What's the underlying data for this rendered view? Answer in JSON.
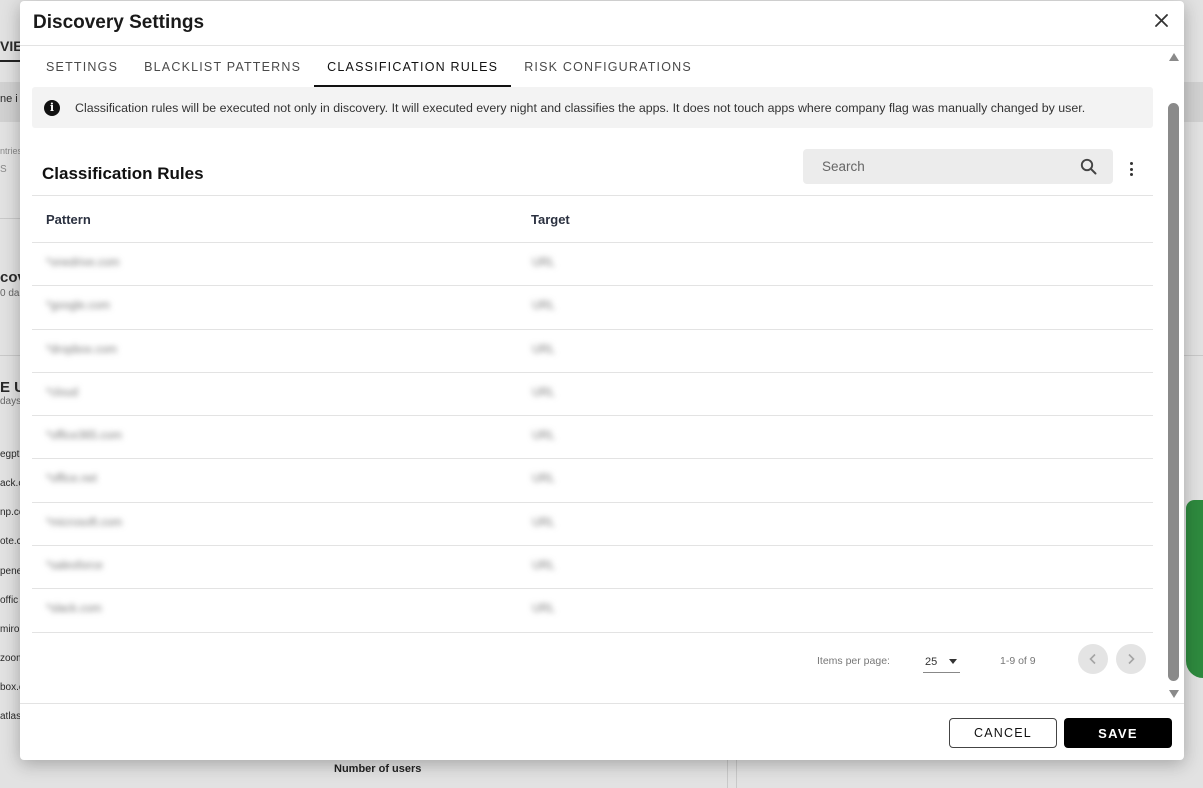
{
  "background": {
    "tab_fragment": "VIEV",
    "fragments": [
      "ne i",
      "ntries",
      "S",
      "cov",
      "0 da",
      "E US",
      "days",
      "egpt",
      "ack.c",
      "np.co",
      "ote.c",
      "pene",
      "offic",
      "miro.c",
      "zoom",
      "box.c",
      "atlas"
    ],
    "footer_label": "Number of users",
    "map_color": "#2e8a3e"
  },
  "dialog": {
    "title": "Discovery Settings",
    "close_icon": "close-icon"
  },
  "tabs": [
    {
      "label": "SETTINGS",
      "active": false
    },
    {
      "label": "BLACKLIST PATTERNS",
      "active": false
    },
    {
      "label": "CLASSIFICATION RULES",
      "active": true
    },
    {
      "label": "RISK CONFIGURATIONS",
      "active": false
    }
  ],
  "info": {
    "icon": "info-icon",
    "text": "Classification rules will be executed not only in discovery. It will executed every night and classifies the apps. It does not touch apps where company flag was manually changed by user."
  },
  "rules": {
    "title": "Classification Rules",
    "search_placeholder": "Search",
    "search_icon": "search-icon",
    "more_icon": "more-vert-icon",
    "columns": {
      "pattern": "Pattern",
      "target": "Target"
    },
    "rows": [
      {
        "pattern": "*onedrive.com",
        "target": "URL"
      },
      {
        "pattern": "*google.com",
        "target": "URL"
      },
      {
        "pattern": "*dropbox.com",
        "target": "URL"
      },
      {
        "pattern": "*cloud",
        "target": "URL"
      },
      {
        "pattern": "*office365.com",
        "target": "URL"
      },
      {
        "pattern": "*office.net",
        "target": "URL"
      },
      {
        "pattern": "*microsoft.com",
        "target": "URL"
      },
      {
        "pattern": "*salesforce",
        "target": "URL"
      },
      {
        "pattern": "*slack.com",
        "target": "URL"
      }
    ]
  },
  "paginator": {
    "items_label": "Items per page:",
    "page_size": "25",
    "range": "1-9 of 9",
    "prev_icon": "chevron-left-icon",
    "next_icon": "chevron-right-icon"
  },
  "footer": {
    "cancel_label": "CANCEL",
    "save_label": "SAVE"
  },
  "colors": {
    "primary_button": "#000000",
    "info_background": "#f3f3f3"
  }
}
